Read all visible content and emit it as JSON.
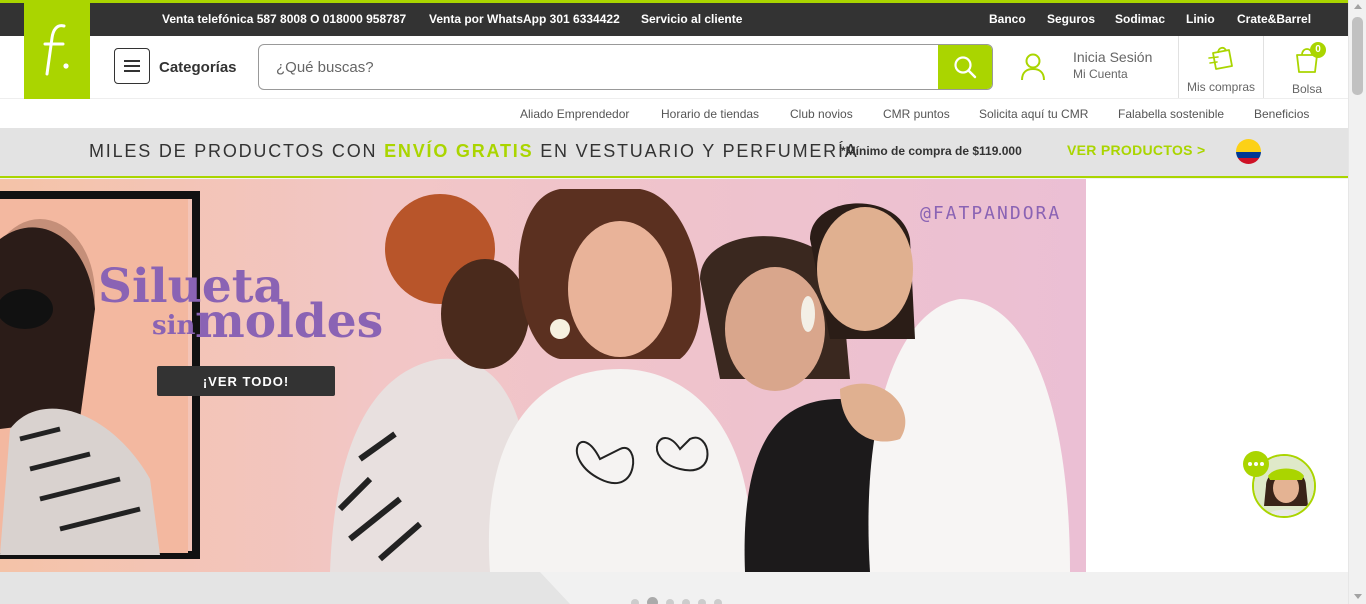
{
  "colors": {
    "brand_green": "#aad500",
    "topbar": "#333333",
    "colombia_flag": [
      "#fcd116",
      "#003893",
      "#ce1126"
    ]
  },
  "logo": {
    "glyph": "f.",
    "icon": "falabella-logo-icon"
  },
  "topbar": {
    "links": [
      "Venta telefónica 587 8008 O 018000 958787",
      "Venta por WhatsApp 301 6334422",
      "Servicio al cliente",
      "Banco",
      "Seguros",
      "Sodimac",
      "Linio",
      "Crate&Barrel"
    ]
  },
  "header": {
    "menu_icon": "hamburger-icon",
    "categories_label": "Categorías",
    "search": {
      "placeholder": "¿Qué buscas?",
      "value": "",
      "icon": "search-icon"
    },
    "account": {
      "line1": "Inicia Sesión",
      "line2": "Mi Cuenta",
      "icon": "user-icon"
    },
    "orders": {
      "label": "Mis compras",
      "icon": "shopping-bag-icon"
    },
    "bag": {
      "label": "Bolsa",
      "count": "0",
      "icon": "bag-icon"
    }
  },
  "subnav": {
    "items": [
      "Aliado Emprendedor",
      "Horario de tiendas",
      "Club novios",
      "CMR puntos",
      "Solicita aquí tu CMR",
      "Falabella sostenible",
      "Beneficios"
    ]
  },
  "promo": {
    "before": "MILES DE PRODUCTOS CON ",
    "highlight": "ENVÍO GRATIS",
    "after": " EN VESTUARIO Y PERFUMERÍA",
    "minimum": "*Mínimo de compra de $119.000",
    "cta": "VER PRODUCTOS >",
    "flag_icon": "colombia-flag-icon"
  },
  "banner": {
    "title_line1": "Silueta",
    "title_sin": "sin",
    "title_line2": "moldes",
    "button": "¡VER TODO!",
    "handle": "@FATPANDORA"
  },
  "carousel": {
    "slides": 6,
    "active": 2
  },
  "chat": {
    "icon": "chat-assistant-icon"
  }
}
